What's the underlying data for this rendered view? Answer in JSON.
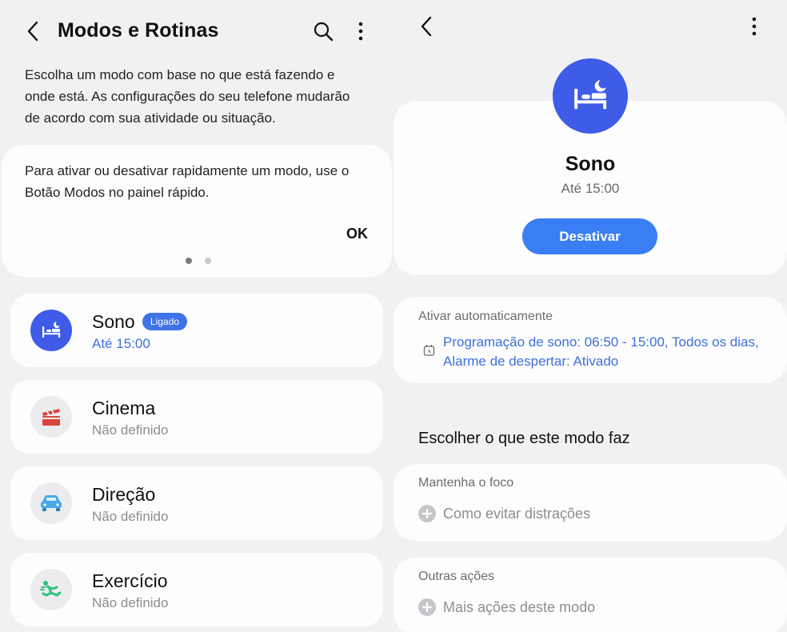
{
  "left": {
    "header": {
      "title": "Modos e Rotinas"
    },
    "intro_text": "Escolha um modo com base no que está fazendo e onde está. As configurações do seu telefone mudarão de acordo com sua atividade ou situação.",
    "tip": {
      "text": "Para ativar ou desativar rapidamente um modo, use o Botão Modos no painel rápido.",
      "ok_label": "OK",
      "page_count": 2,
      "active_page": 1
    },
    "modes": [
      {
        "name": "Sono",
        "status": "Até 15:00",
        "badge": "Ligado",
        "icon": "bed-moon-icon",
        "icon_bg": "#3e5ce8",
        "active": true
      },
      {
        "name": "Cinema",
        "status": "Não definido",
        "icon": "clapperboard-icon",
        "icon_bg": "#ececee",
        "active": false
      },
      {
        "name": "Direção",
        "status": "Não definido",
        "icon": "car-icon",
        "icon_bg": "#ececee",
        "active": false
      },
      {
        "name": "Exercício",
        "status": "Não definido",
        "icon": "running-icon",
        "icon_bg": "#ececee",
        "active": false
      }
    ]
  },
  "right": {
    "mode": {
      "title": "Sono",
      "until": "Até 15:00",
      "button_label": "Desativar",
      "icon": "bed-moon-icon"
    },
    "auto": {
      "label": "Ativar automaticamente",
      "schedule_text": "Programação de sono: 06:50 - 15:00, Todos os dias, Alarme de despertar: Ativado"
    },
    "section_heading": "Escolher o que este modo faz",
    "focus": {
      "label": "Mantenha o foco",
      "action": "Como evitar distrações"
    },
    "other": {
      "label": "Outras ações",
      "action": "Mais ações deste modo"
    }
  },
  "colors": {
    "accent": "#3a7ef3",
    "link": "#3f6fd8",
    "sleep_icon_bg": "#3e5ce8",
    "card_bg": "#fdfdfe",
    "screen_bg": "#f1f1f3"
  }
}
